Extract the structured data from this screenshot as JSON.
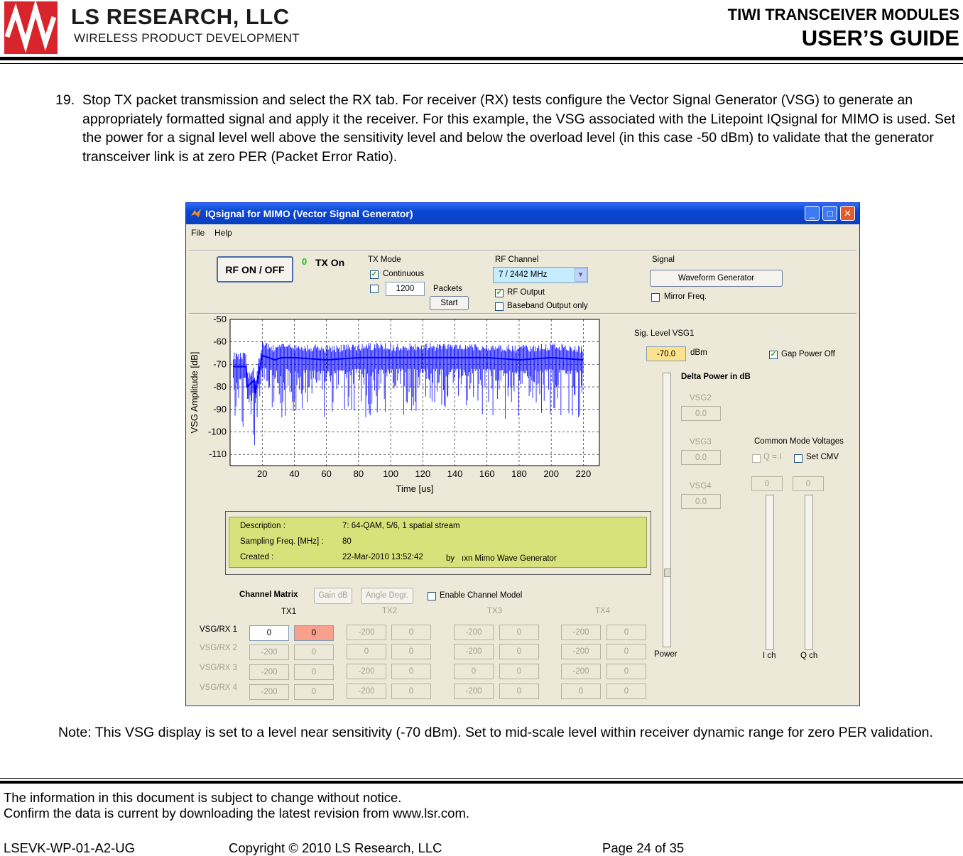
{
  "header": {
    "company": "LS RESEARCH, LLC",
    "tagline": "WIRELESS PRODUCT DEVELOPMENT",
    "doc_title_1": "TIWI TRANSCEIVER MODULES",
    "doc_title_2": "USER’S GUIDE"
  },
  "step": {
    "number": "19.",
    "text": "Stop TX packet transmission and select the RX tab. For receiver (RX) tests configure the Vector Signal Generator (VSG) to generate an appropriately formatted signal and apply it the receiver. For this example, the VSG associated with the Litepoint IQsignal for MIMO is used. Set the power for a signal level well above the sensitivity level and below the overload level (in this case -50 dBm) to validate that the generator transceiver link is at zero PER (Packet Error Ratio)."
  },
  "app": {
    "title": "IQsignal for MIMO (Vector Signal Generator)",
    "menu": [
      "File",
      "Help"
    ],
    "rf_button": "RF ON / OFF",
    "tx_indicator": "0",
    "tx_status": "TX On",
    "tx_mode_label": "TX Mode",
    "continuous_label": "Continuous",
    "packet_count": "1200",
    "packets_label": "Packets",
    "start_button": "Start",
    "rf_channel_label": "RF Channel",
    "rf_channel_value": "7  /   2442 MHz",
    "rf_output_label": "RF Output",
    "baseband_label": "Baseband Output only",
    "signal_label": "Signal",
    "waveform_button": "Waveform Generator",
    "mirror_label": "Mirror Freq.",
    "sig_level_label": "Sig. Level VSG1",
    "sig_level_value": "-70.0",
    "sig_level_unit": "dBm",
    "gap_power_label": "Gap Power Off",
    "delta_power_label": "Delta Power in dB",
    "vsg_labels": [
      "VSG2",
      "VSG3",
      "VSG4"
    ],
    "vsg_values": [
      "0.0",
      "0.0",
      "0.0"
    ],
    "common_mode_label": "Common Mode Voltages",
    "qi_label": "Q = I",
    "set_cmv_label": "Set CMV",
    "cmv_values": [
      "0",
      "0"
    ],
    "power_label": "Power",
    "ich_label": "I ch",
    "qch_label": "Q ch",
    "description": {
      "rows": [
        {
          "key": "Description :",
          "value": "7: 64-QAM, 5/6, 1 spatial stream"
        },
        {
          "key": "Sampling Freq. [MHz] :",
          "value": "80"
        },
        {
          "key": "Created :",
          "value": "22-Mar-2010 13:52:42"
        }
      ],
      "by_label": "by",
      "by_value": "ıxn Mimo Wave Generator"
    },
    "channel_matrix": {
      "label": "Channel Matrix",
      "gain_button": "Gain dB",
      "angle_button": "Angle Degr.",
      "enable_label": "Enable Channel Model",
      "tx_headers": [
        "TX1",
        "TX2",
        "TX3",
        "TX4"
      ],
      "row_labels": [
        "VSG/RX 1",
        "VSG/RX 2",
        "VSG/RX 3",
        "VSG/RX 4"
      ],
      "rows": [
        [
          "0",
          "0",
          "-200",
          "0",
          "-200",
          "0",
          "-200",
          "0"
        ],
        [
          "-200",
          "0",
          "0",
          "0",
          "-200",
          "0",
          "-200",
          "0"
        ],
        [
          "-200",
          "0",
          "-200",
          "0",
          "0",
          "0",
          "-200",
          "0"
        ],
        [
          "-200",
          "0",
          "-200",
          "0",
          "-200",
          "0",
          "0",
          "0"
        ]
      ]
    }
  },
  "chart_data": {
    "type": "line",
    "xlabel": "Time [us]",
    "ylabel": "VSG Amplitude [dB]",
    "xlim": [
      0,
      230
    ],
    "ylim": [
      -115,
      -50
    ],
    "xticks": [
      "20",
      "40",
      "60",
      "80",
      "100",
      "120",
      "140",
      "160",
      "180",
      "200",
      "220"
    ],
    "yticks": [
      "-50",
      "-60",
      "-70",
      "-80",
      "-90",
      "-100",
      "-110"
    ],
    "grid": true,
    "line_color": "#0000ff",
    "series": [
      {
        "x": [
          2,
          10,
          10.5,
          15,
          15.5,
          20,
          24,
          28,
          32,
          40,
          60,
          80,
          100,
          120,
          140,
          160,
          180,
          200,
          220
        ],
        "y": [
          -71,
          -71,
          -80,
          -77,
          -83,
          -66,
          -67,
          -68,
          -67,
          -67,
          -68,
          -67,
          -67,
          -67,
          -67,
          -67,
          -68,
          -67,
          -68
        ]
      }
    ]
  },
  "note": "Note: This VSG display is set to a level near sensitivity (-70 dBm). Set to mid-scale level within receiver dynamic range for zero PER validation.",
  "footer": {
    "line1": "The information in this document is subject to change without notice.",
    "line2": "Confirm the data is current by downloading the latest revision from www.lsr.com.",
    "doc_id": "LSEVK-WP-01-A2-UG",
    "copyright": "Copyright © 2010 LS Research, LLC",
    "page": "Page 24 of 35"
  }
}
